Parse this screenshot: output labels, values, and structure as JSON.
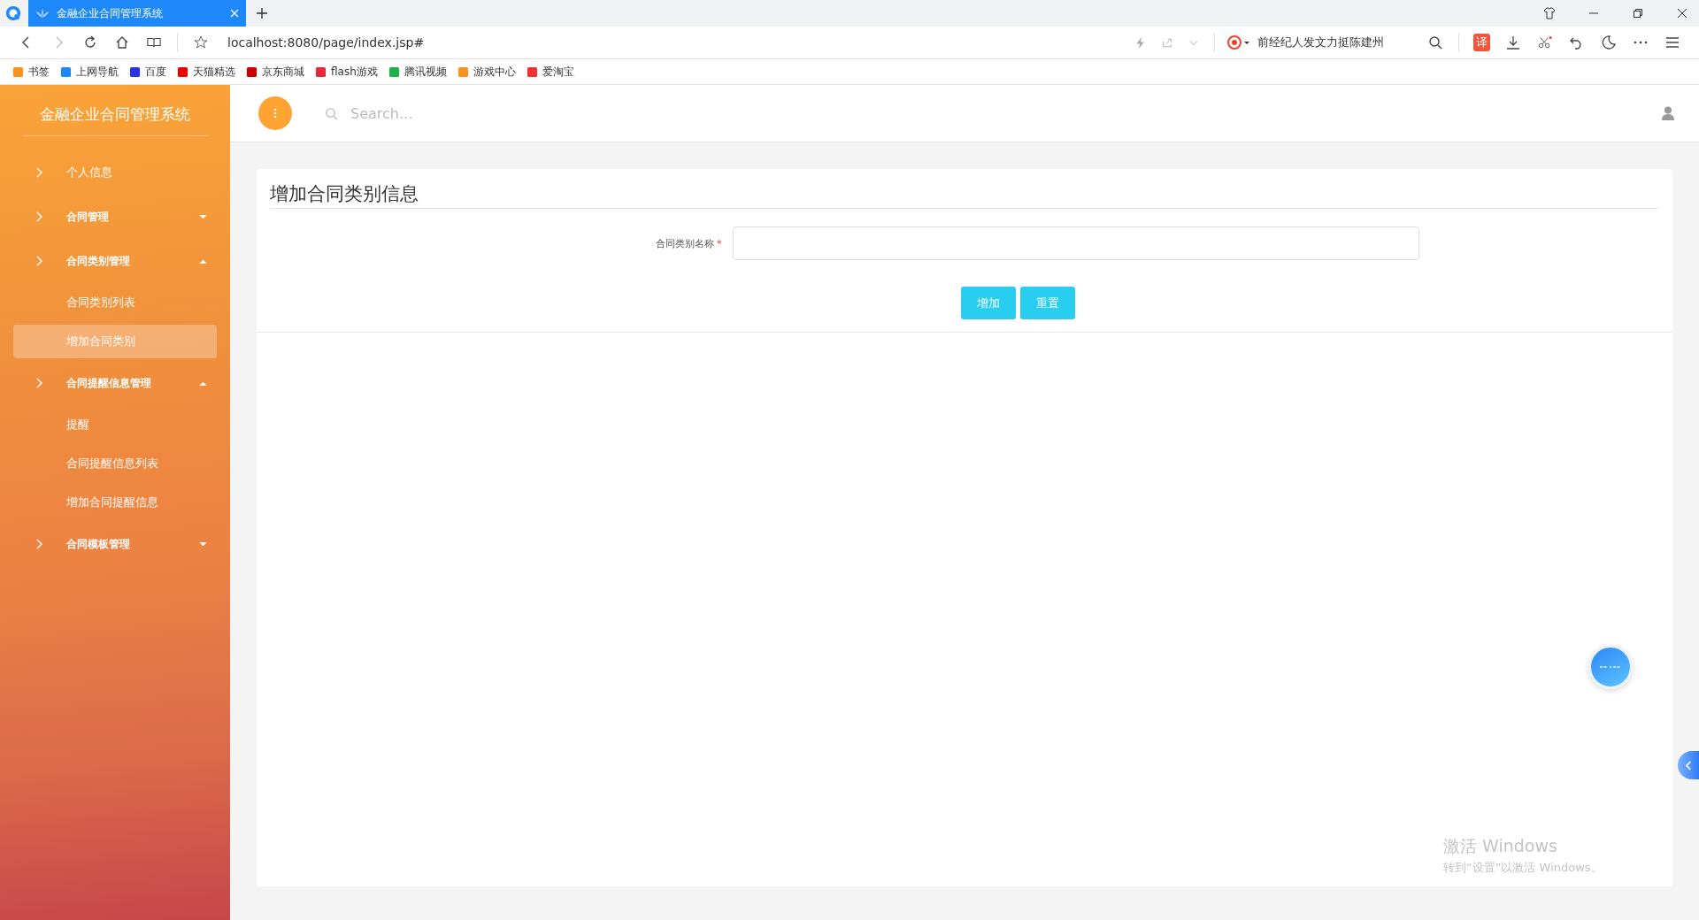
{
  "browser": {
    "tabs": [
      {
        "title": "金融企业合同管理系统",
        "selected": true
      }
    ],
    "url": "localhost:8080/page/index.jsp#",
    "search_text": "前经纪人发文力挺陈建州",
    "translate_label": "译",
    "bookmarks": [
      {
        "label": "书签"
      },
      {
        "label": "上网导航"
      },
      {
        "label": "百度"
      },
      {
        "label": "天猫精选"
      },
      {
        "label": "京东商城"
      },
      {
        "label": "flash游戏"
      },
      {
        "label": "腾讯视频"
      },
      {
        "label": "游戏中心"
      },
      {
        "label": "爱淘宝"
      }
    ]
  },
  "sidebar": {
    "title": "金融企业合同管理系统",
    "items": [
      {
        "kind": "link",
        "label": "个人信息"
      },
      {
        "kind": "group",
        "label": "合同管理",
        "expanded": false
      },
      {
        "kind": "group",
        "label": "合同类别管理",
        "expanded": true,
        "children": [
          {
            "label": "合同类别列表",
            "selected": false
          },
          {
            "label": "增加合同类别",
            "selected": true
          }
        ]
      },
      {
        "kind": "group",
        "label": "合同提醒信息管理",
        "expanded": true,
        "children": [
          {
            "label": "提醒",
            "selected": false
          },
          {
            "label": "合同提醒信息列表",
            "selected": false
          },
          {
            "label": "增加合同提醒信息",
            "selected": false
          }
        ]
      },
      {
        "kind": "group",
        "label": "合同模板管理",
        "expanded": false
      }
    ]
  },
  "header": {
    "search": {
      "placeholder": "Search..."
    }
  },
  "form": {
    "title": "增加合同类别信息",
    "fields": [
      {
        "label": "合同类别名称",
        "required": true,
        "required_mark": "*"
      }
    ],
    "buttons": [
      "增加",
      "重置"
    ]
  },
  "os_notice": {
    "title": "激活 Windows",
    "text": "转到“设置”以激活 Windows。"
  }
}
